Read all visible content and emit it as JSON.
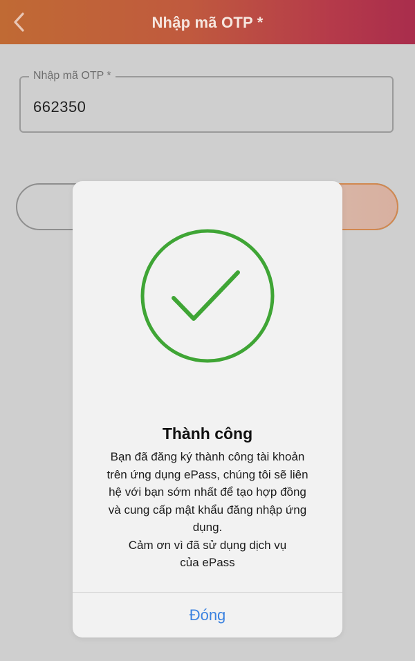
{
  "header": {
    "title": "Nhập mã OTP *",
    "back_icon": "chevron-left-icon"
  },
  "otp_field": {
    "label": "Nhập mã OTP *",
    "value": "662350"
  },
  "modal": {
    "icon": "check-circle-icon",
    "title": "Thành công",
    "message_lines": [
      "Bạn đã đăng ký thành công tài khoản",
      "trên ứng dụng ePass, chúng tôi sẽ liên",
      "hệ với bạn sớm nhất để tạo hợp đồng",
      "và cung cấp mật khẩu đăng nhập ứng",
      "dụng.",
      "Cảm ơn vì đã sử dụng dịch vụ",
      "của ePass"
    ],
    "close_label": "Đóng"
  },
  "colors": {
    "header_gradient": [
      "#c06a34",
      "#a92d4c"
    ],
    "success_green": "#3fa535",
    "link_blue": "#3b82e0",
    "background_dim": "#cfcfcf",
    "modal_bg": "#f2f2f2"
  }
}
